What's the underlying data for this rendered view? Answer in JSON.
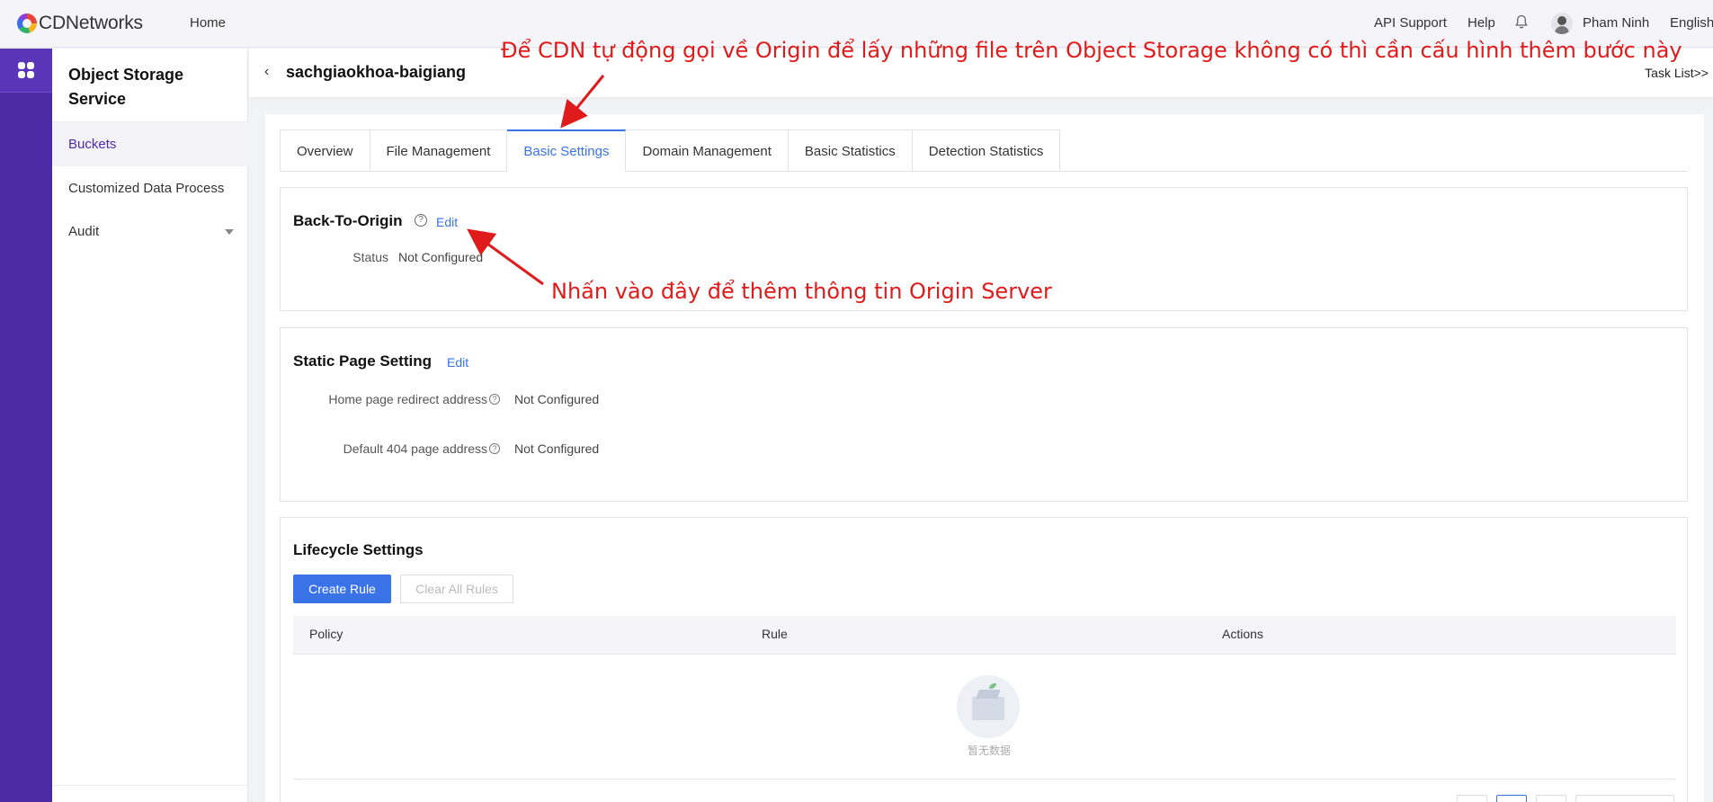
{
  "brand": {
    "name": "CDNetworks"
  },
  "topnav": {
    "home": "Home",
    "api_support": "API Support",
    "help": "Help",
    "user_name": "Pham Ninh",
    "language": "English"
  },
  "sidebar": {
    "title": "Object Storage Service",
    "items": [
      {
        "label": "Buckets",
        "active": true
      },
      {
        "label": "Customized Data Process",
        "active": false
      },
      {
        "label": "Audit",
        "active": false
      }
    ]
  },
  "header": {
    "bucket_name": "sachgiaokhoa-baigiang",
    "task_list": "Task List>>"
  },
  "tabs": [
    {
      "label": "Overview",
      "active": false
    },
    {
      "label": "File Management",
      "active": false
    },
    {
      "label": "Basic Settings",
      "active": true
    },
    {
      "label": "Domain Management",
      "active": false
    },
    {
      "label": "Basic Statistics",
      "active": false
    },
    {
      "label": "Detection Statistics",
      "active": false
    }
  ],
  "back_to_origin": {
    "title": "Back-To-Origin",
    "edit": "Edit",
    "status_label": "Status",
    "status_value": "Not Configured"
  },
  "static_page": {
    "title": "Static Page Setting",
    "edit": "Edit",
    "home_label": "Home page redirect address",
    "home_value": "Not Configured",
    "default404_label": "Default 404 page address",
    "default404_value": "Not Configured"
  },
  "lifecycle": {
    "title": "Lifecycle Settings",
    "create_rule": "Create Rule",
    "clear_all": "Clear All Rules",
    "columns": [
      "Policy",
      "Rule",
      "Actions"
    ],
    "empty_text": "暂无数据"
  },
  "annotations": {
    "top_note": "Để CDN tự động gọi về Origin để lấy những file trên Object Storage không có thì cần cấu hình thêm bước này",
    "edit_note": "Nhấn vào đây để thêm thông tin Origin Server",
    "color": "#e01b1b"
  },
  "colors": {
    "accent": "#3a73e8",
    "rail": "#4b2aa6"
  }
}
